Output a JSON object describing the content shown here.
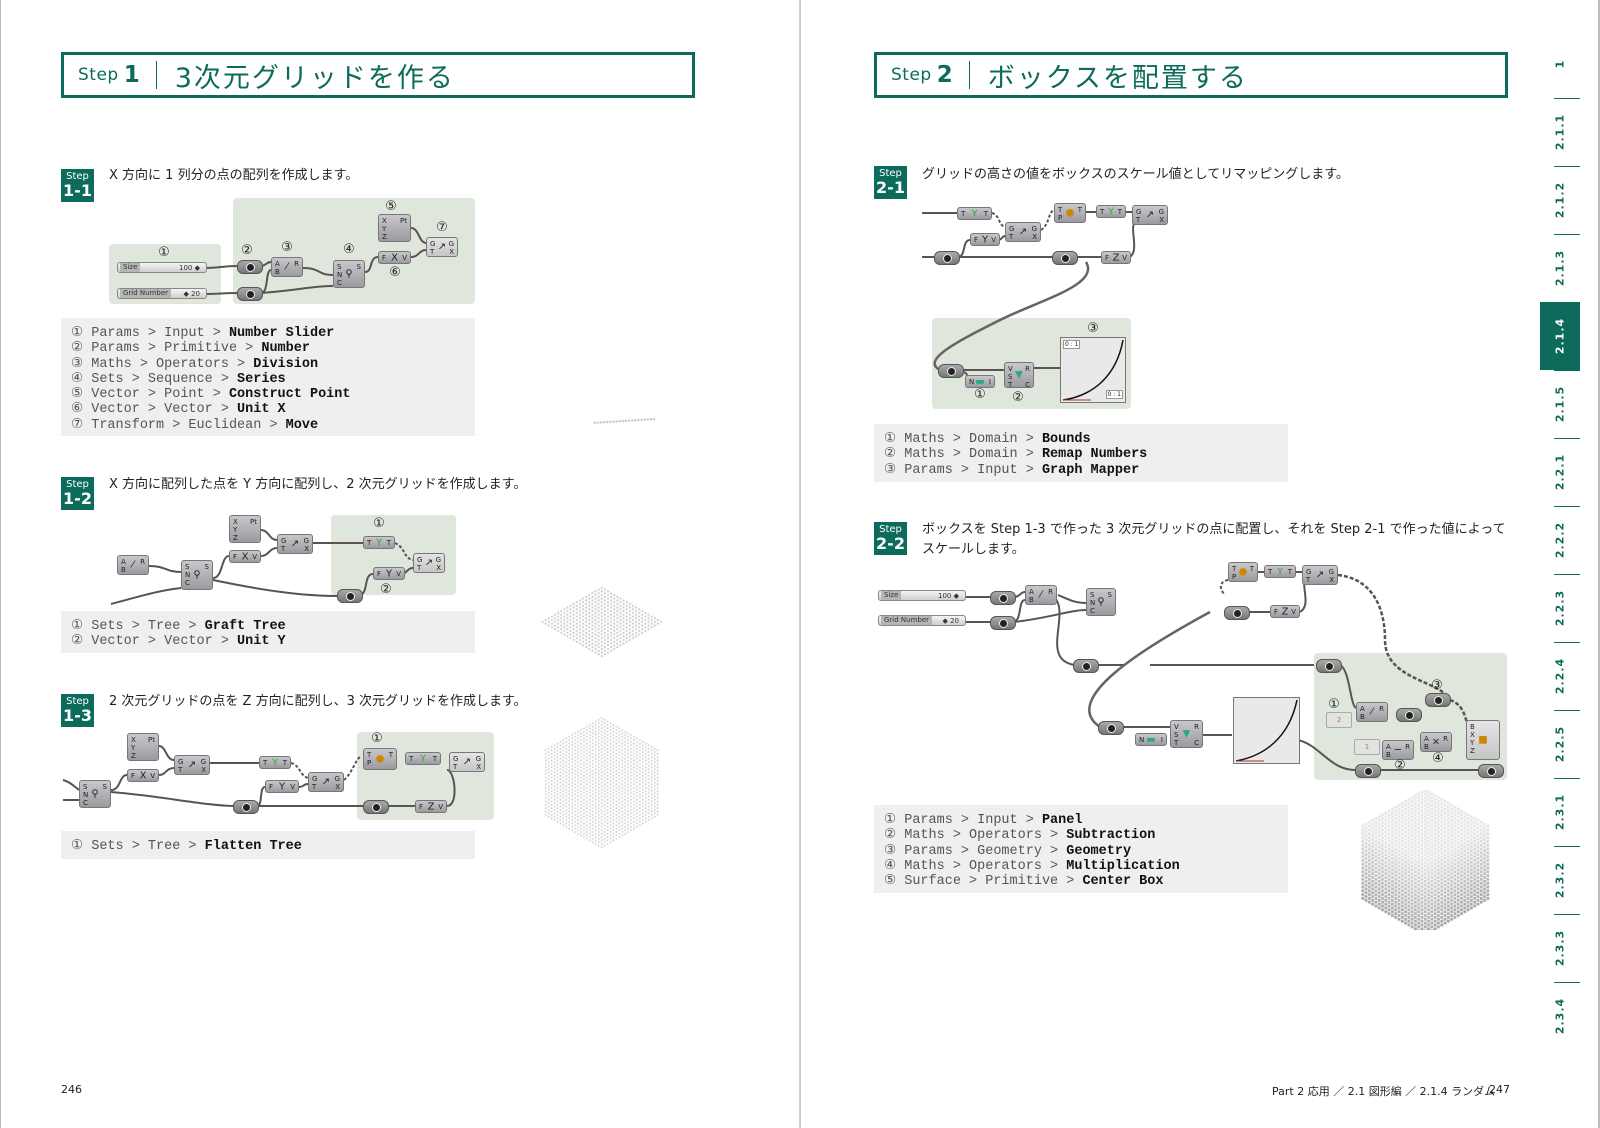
{
  "left_page": {
    "header": {
      "step_word": "Step",
      "step_num": "1",
      "title": "3次元グリッドを作る"
    },
    "steps": [
      {
        "badge_top": "Step",
        "badge_num": "1-1",
        "description": "X 方向に 1 列分の点の配列を作成します。",
        "diagram": {
          "markers": [
            "①",
            "②",
            "③",
            "④",
            "⑤",
            "⑥",
            "⑦"
          ],
          "sliders": [
            {
              "label": "Size",
              "value": "100 ◆"
            },
            {
              "label": "Grid Number",
              "value": "◆ 20"
            }
          ]
        },
        "components": [
          {
            "marker": "①",
            "path": "Params > Input > ",
            "name": "Number Slider"
          },
          {
            "marker": "②",
            "path": "Params > Primitive > ",
            "name": "Number"
          },
          {
            "marker": "③",
            "path": "Maths > Operators > ",
            "name": "Division"
          },
          {
            "marker": "④",
            "path": "Sets > Sequence > ",
            "name": "Series"
          },
          {
            "marker": "⑤",
            "path": "Vector > Point > ",
            "name": "Construct Point"
          },
          {
            "marker": "⑥",
            "path": "Vector > Vector > ",
            "name": "Unit X"
          },
          {
            "marker": "⑦",
            "path": "Transform > Euclidean > ",
            "name": "Move"
          }
        ]
      },
      {
        "badge_top": "Step",
        "badge_num": "1-2",
        "description": "X 方向に配列した点を Y 方向に配列し、2 次元グリッドを作成します。",
        "diagram": {
          "markers": [
            "①",
            "②"
          ]
        },
        "components": [
          {
            "marker": "①",
            "path": "Sets > Tree > ",
            "name": "Graft Tree"
          },
          {
            "marker": "②",
            "path": "Vector > Vector > ",
            "name": "Unit Y"
          }
        ]
      },
      {
        "badge_top": "Step",
        "badge_num": "1-3",
        "description": "2 次元グリッドの点を Z 方向に配列し、3 次元グリッドを作成します。",
        "diagram": {
          "markers": [
            "①"
          ]
        },
        "components": [
          {
            "marker": "①",
            "path": "Sets > Tree > ",
            "name": "Flatten Tree"
          }
        ]
      }
    ],
    "page_number": "246"
  },
  "right_page": {
    "header": {
      "step_word": "Step",
      "step_num": "2",
      "title": "ボックスを配置する"
    },
    "steps": [
      {
        "badge_top": "Step",
        "badge_num": "2-1",
        "description": "グリッドの高さの値をボックスのスケール値としてリマッピングします。",
        "diagram": {
          "markers": [
            "①",
            "②",
            "③"
          ],
          "graph_labels": [
            "0 : 1",
            "0 : 1"
          ]
        },
        "components": [
          {
            "marker": "①",
            "path": "Maths > Domain > ",
            "name": "Bounds"
          },
          {
            "marker": "②",
            "path": "Maths > Domain > ",
            "name": "Remap Numbers"
          },
          {
            "marker": "③",
            "path": "Params > Input > ",
            "name": "Graph Mapper"
          }
        ]
      },
      {
        "badge_top": "Step",
        "badge_num": "2-2",
        "description": "ボックスを Step 1-3 で作った 3 次元グリッドの点に配置し、それを Step 2-1 で作った値によってスケールします。",
        "diagram": {
          "markers": [
            "①",
            "②",
            "③",
            "④"
          ],
          "sliders": [
            {
              "label": "Size",
              "value": "100 ◆"
            },
            {
              "label": "Grid Number",
              "value": "◆ 20"
            }
          ],
          "panels": [
            "2",
            "1"
          ]
        },
        "components": [
          {
            "marker": "①",
            "path": "Params > Input > ",
            "name": "Panel"
          },
          {
            "marker": "②",
            "path": "Maths > Operators > ",
            "name": "Subtraction"
          },
          {
            "marker": "③",
            "path": "Params > Geometry > ",
            "name": "Geometry"
          },
          {
            "marker": "④",
            "path": "Maths > Operators > ",
            "name": "Multiplication"
          },
          {
            "marker": "⑤",
            "path": "Surface > Primitive > ",
            "name": "Center Box"
          }
        ]
      }
    ],
    "footer_breadcrumb": "Part 2 応用 ／ 2.1 図形編 ／ 2.1.4 ランダム",
    "page_number": "247"
  },
  "chapter_tabs": {
    "accent_color": "#0c6b5a",
    "active": "2.1.4",
    "items": [
      "1",
      "2.1.1",
      "2.1.2",
      "2.1.3",
      "2.1.4",
      "2.1.5",
      "2.2.1",
      "2.2.2",
      "2.2.3",
      "2.2.4",
      "2.2.5",
      "2.3.1",
      "2.3.2",
      "2.3.3",
      "2.3.4"
    ]
  }
}
